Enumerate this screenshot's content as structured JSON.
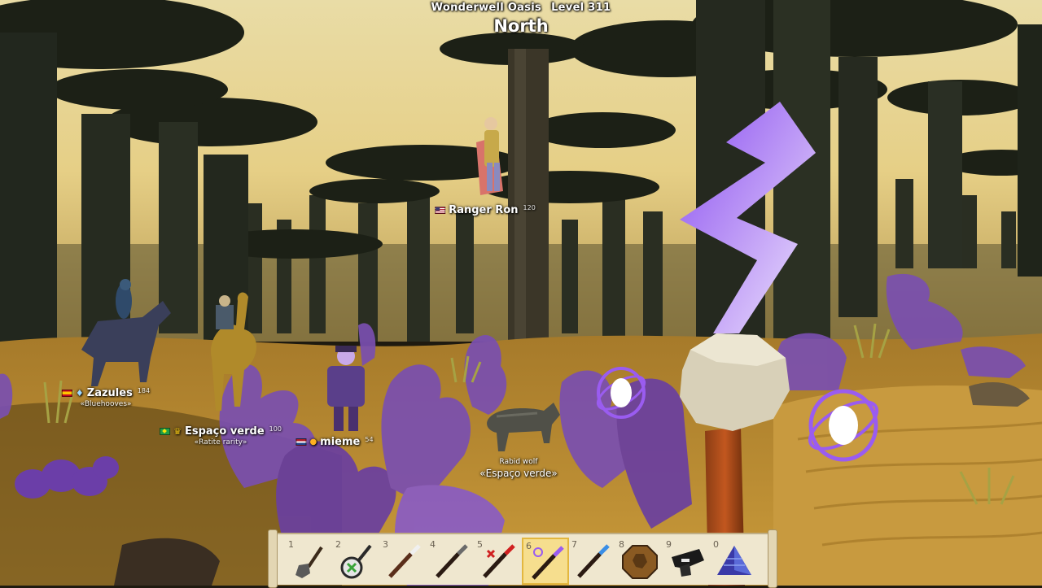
{
  "hud": {
    "zone": "Wonderwell Oasis",
    "level": "Level 311",
    "compass": "North"
  },
  "players": [
    {
      "name": "Ranger Ron",
      "level": "120",
      "flag": "us",
      "badge": "",
      "subtitle": ""
    },
    {
      "name": "Zazules",
      "level": "184",
      "flag": "es",
      "badge": "gem",
      "subtitle": "«Bluehooves»"
    },
    {
      "name": "Espaço verde",
      "level": "100",
      "flag": "br",
      "badge": "crown",
      "subtitle": "«Ratite rarity»"
    },
    {
      "name": "mieme",
      "level": "54",
      "flag": "nl",
      "badge": "drop",
      "subtitle": ""
    }
  ],
  "creature": {
    "name": "Rabid wolf",
    "owner": "«Espaço verde»"
  },
  "hotbar": {
    "selected_slot": 6,
    "slots": [
      {
        "key": "1",
        "icon": "shovel-icon"
      },
      {
        "key": "2",
        "icon": "banjo-icon"
      },
      {
        "key": "3",
        "icon": "white-wand-icon"
      },
      {
        "key": "4",
        "icon": "dark-wand-icon"
      },
      {
        "key": "5",
        "icon": "red-wand-icon"
      },
      {
        "key": "6",
        "icon": "purple-wand-icon"
      },
      {
        "key": "7",
        "icon": "blue-wand-icon"
      },
      {
        "key": "8",
        "icon": "brown-shield-icon"
      },
      {
        "key": "9",
        "icon": "black-hat-icon"
      },
      {
        "key": "0",
        "icon": "blue-pyramid-icon"
      }
    ]
  },
  "colors": {
    "sky": "#e8d9a0",
    "ground": "#c99a3a",
    "foliage": "#1d2119",
    "purple_plant": "#7a4fb0",
    "rune": "#b98af0",
    "hotbar_bg": "#efe7cf",
    "hotbar_selected": "#f6de8e"
  }
}
